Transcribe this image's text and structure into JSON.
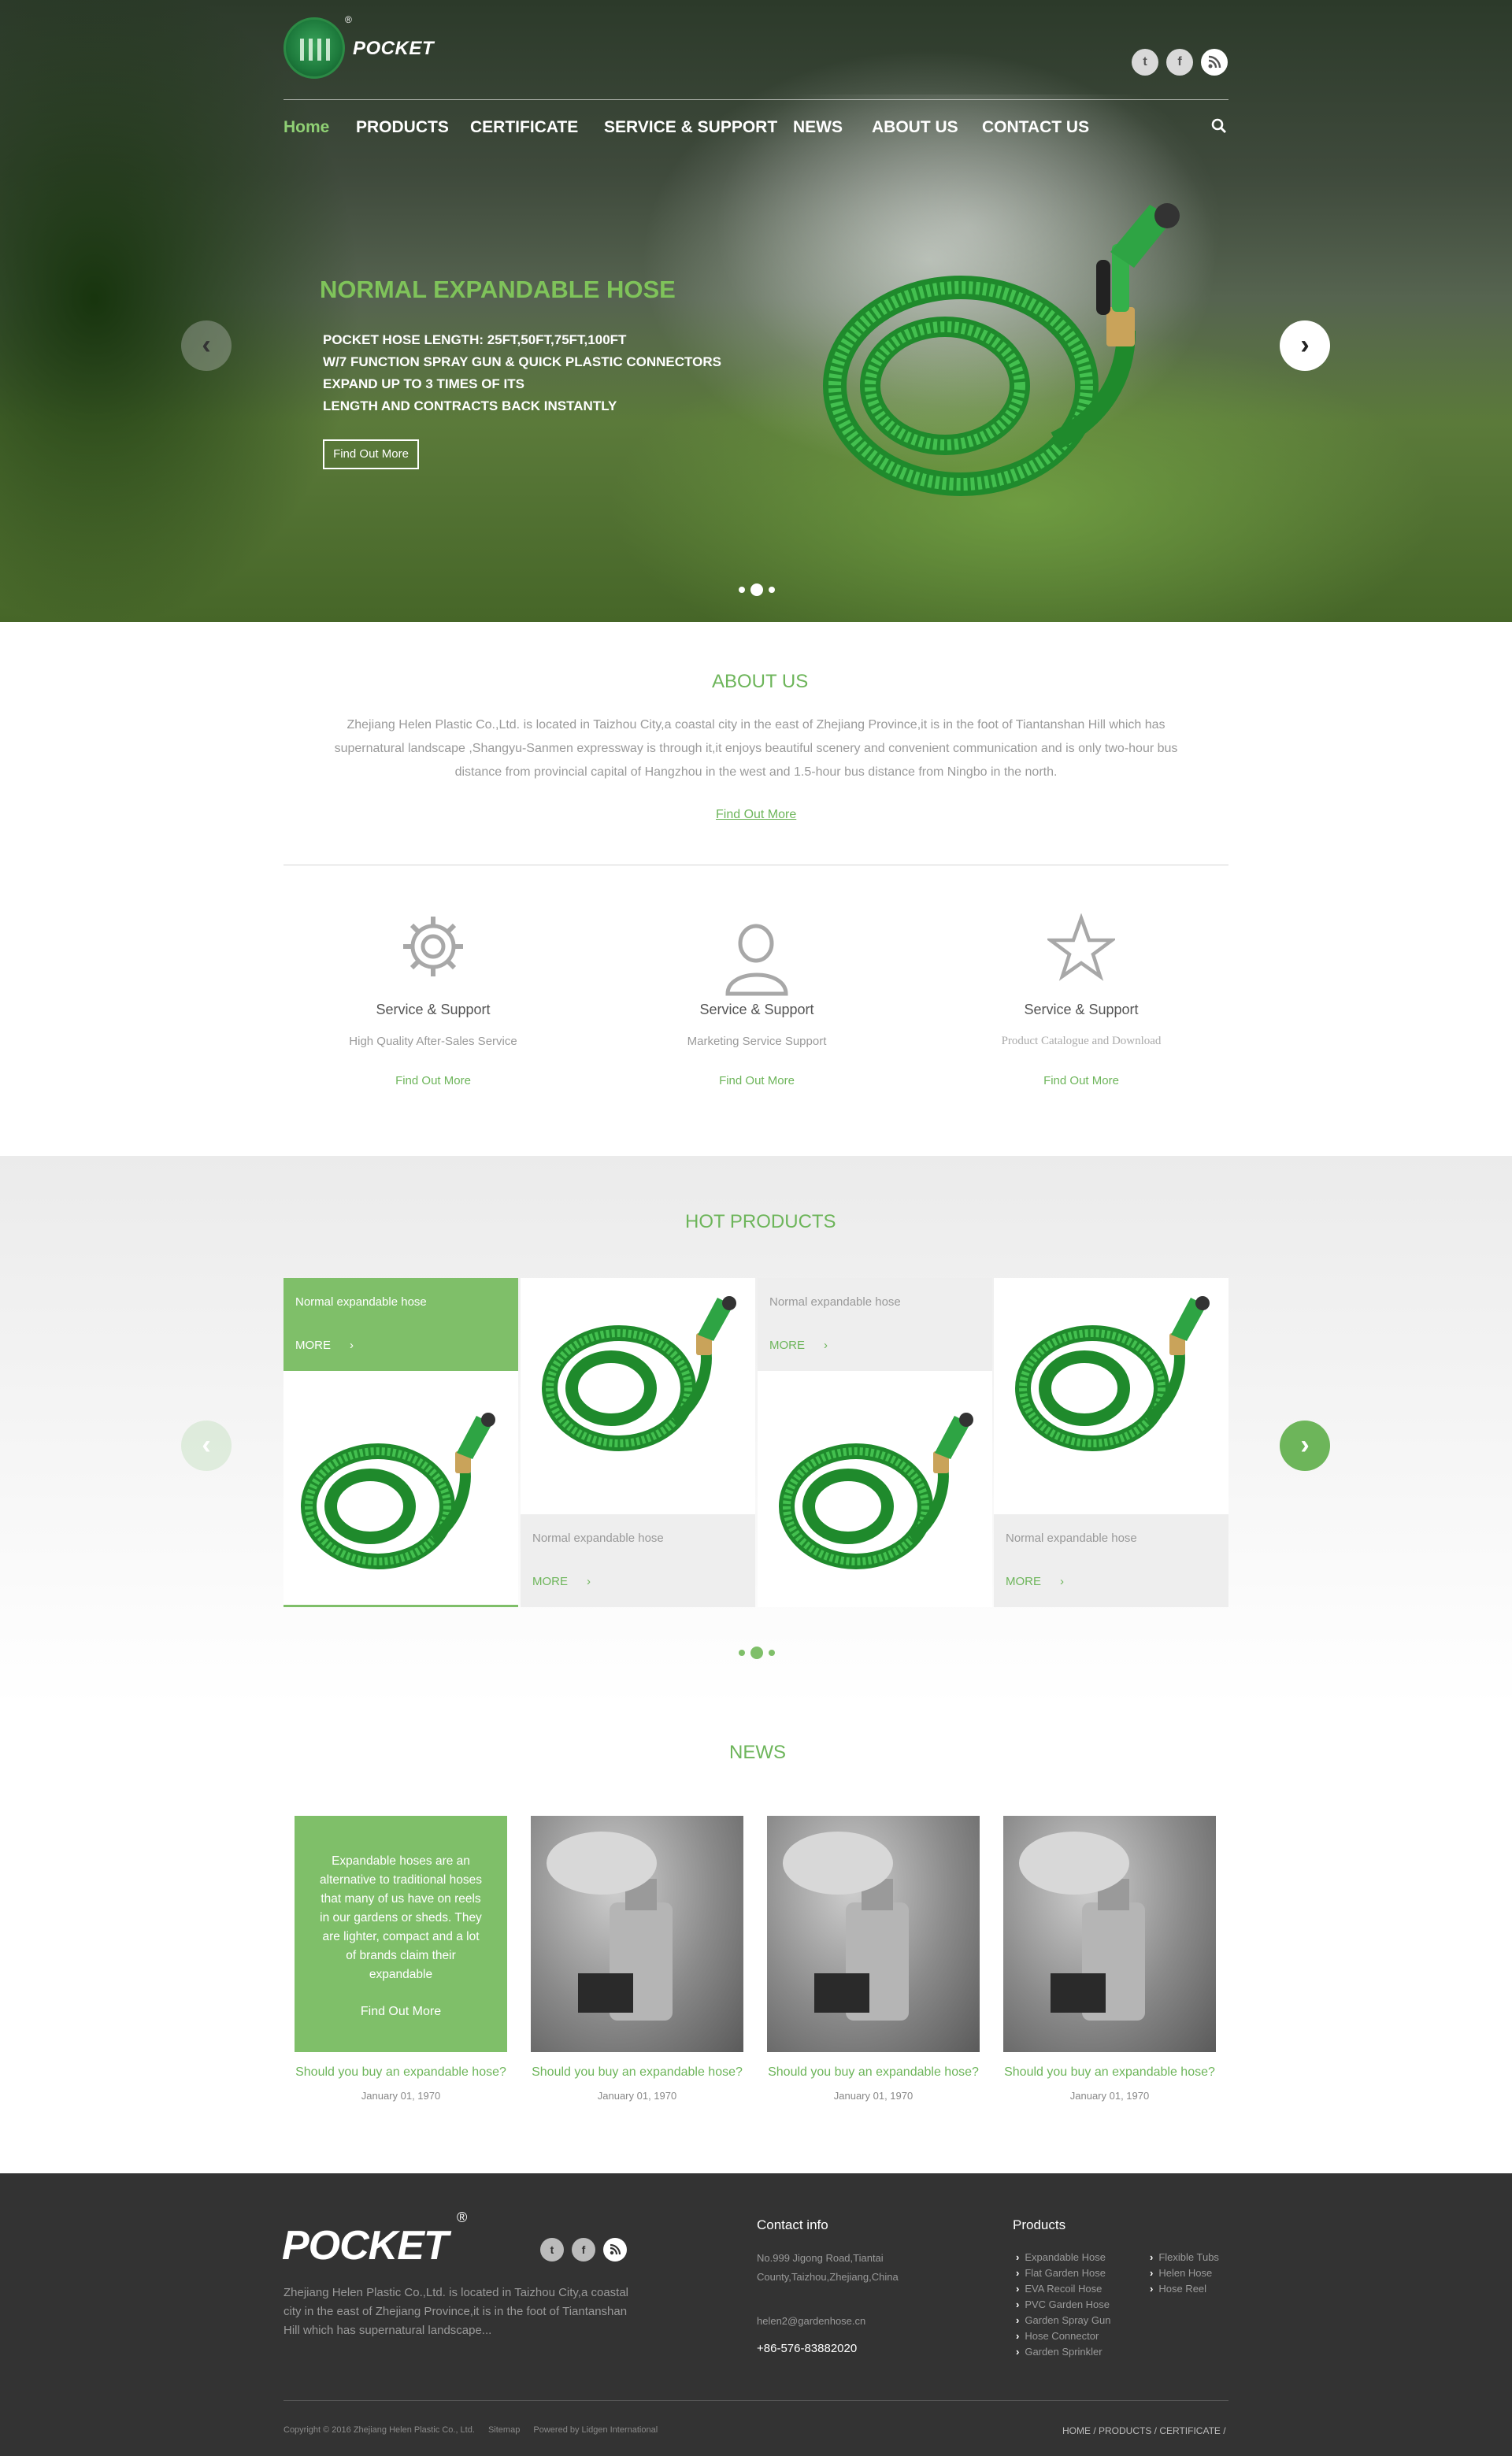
{
  "brand": {
    "name": "POCKET",
    "reg": "®"
  },
  "nav": {
    "items": [
      {
        "label": "Home",
        "active": true
      },
      {
        "label": "PRODUCTS"
      },
      {
        "label": "CERTIFICATE"
      },
      {
        "label": "SERVICE & SUPPORT"
      },
      {
        "label": "NEWS"
      },
      {
        "label": "ABOUT US"
      },
      {
        "label": "CONTACT US"
      }
    ],
    "search_icon": "search-icon",
    "social": [
      "twitter-icon",
      "facebook-icon",
      "rss-icon"
    ]
  },
  "hero": {
    "title": "NORMAL EXPANDABLE HOSE",
    "lines": [
      "POCKET HOSE LENGTH: 25FT,50FT,75FT,100FT",
      "W/7 FUNCTION SPRAY GUN & QUICK PLASTIC CONNECTORS",
      "EXPAND UP TO 3 TIMES OF ITS",
      "LENGTH AND CONTRACTS BACK INSTANTLY"
    ],
    "button": "Find Out More",
    "slides": 3,
    "active_slide": 2
  },
  "about": {
    "title": "ABOUT US",
    "text": "Zhejiang Helen Plastic Co.,Ltd. is located in Taizhou City,a coastal city in the east of Zhejiang Province,it is in the foot of Tiantanshan Hill which has supernatural landscape ,Shangyu-Sanmen expressway is through it,it enjoys beautiful scenery and convenient communication and is only two-hour bus distance from provincial capital of Hangzhou in the west and 1.5-hour bus distance from Ningbo in the north.",
    "link": "Find Out More"
  },
  "services": [
    {
      "icon": "gear-icon",
      "title": "Service & Support",
      "subtitle": "High Quality After-Sales Service",
      "link": "Find Out More"
    },
    {
      "icon": "user-icon",
      "title": "Service & Support",
      "subtitle": "Marketing Service Support",
      "link": "Find Out More"
    },
    {
      "icon": "star-icon",
      "title": "Service & Support",
      "subtitle": "Product Catalogue and Download",
      "link": "Find Out More"
    }
  ],
  "hot_products": {
    "title": "HOT PRODUCTS",
    "items": [
      {
        "name": "Normal expandable hose",
        "more": "MORE",
        "chevron": "›",
        "highlighted": true
      },
      {
        "name": "Normal expandable hose",
        "more": "MORE",
        "chevron": "›"
      },
      {
        "name": "Normal expandable hose",
        "more": "MORE",
        "chevron": "›"
      },
      {
        "name": "Normal expandable hose",
        "more": "MORE",
        "chevron": "›"
      }
    ],
    "pages": 3,
    "active_page": 2
  },
  "news": {
    "title": "NEWS",
    "featured_text": "Expandable hoses are an alternative to traditional hoses that many of us have on reels in our gardens or sheds. They are lighter, compact and a lot of brands claim their expandable",
    "featured_link": "Find Out More",
    "items": [
      {
        "title": "Should you buy an expandable hose?",
        "date": "January 01, 1970"
      },
      {
        "title": "Should you buy an expandable hose?",
        "date": "January 01, 1970"
      },
      {
        "title": "Should you buy an expandable hose?",
        "date": "January 01, 1970"
      },
      {
        "title": "Should you buy an expandable hose?",
        "date": "January 01, 1970"
      }
    ]
  },
  "footer": {
    "desc": "Zhejiang Helen Plastic Co.,Ltd. is located in Taizhou City,a coastal city in the east of Zhejiang Province,it is in the foot of Tiantanshan Hill which has supernatural landscape...",
    "contact_title": "Contact info",
    "address": "No.999 Jigong Road,Tiantai County,Taizhou,Zhejiang,China",
    "email": "helen2@gardenhose.cn",
    "phone": "+86-576-83882020",
    "products_title": "Products",
    "products_col1": [
      "Expandable Hose",
      "Flat Garden Hose",
      "EVA Recoil Hose",
      "PVC Garden Hose",
      "Garden Spray Gun",
      "Hose Connector",
      "Garden Sprinkler"
    ],
    "products_col2": [
      "Flexible Tubs",
      "Helen Hose",
      "Hose Reel"
    ],
    "copyright": "Copyright © 2016 Zhejiang Helen Plastic Co., Ltd.",
    "sitemap": "Sitemap",
    "powered": "Powered by Lidgen International",
    "crumbs": "HOME / PRODUCTS / CERTIFICATE /"
  },
  "colors": {
    "accent": "#6db55a",
    "accent_card": "#7fbf69",
    "footer_bg": "#333333"
  }
}
